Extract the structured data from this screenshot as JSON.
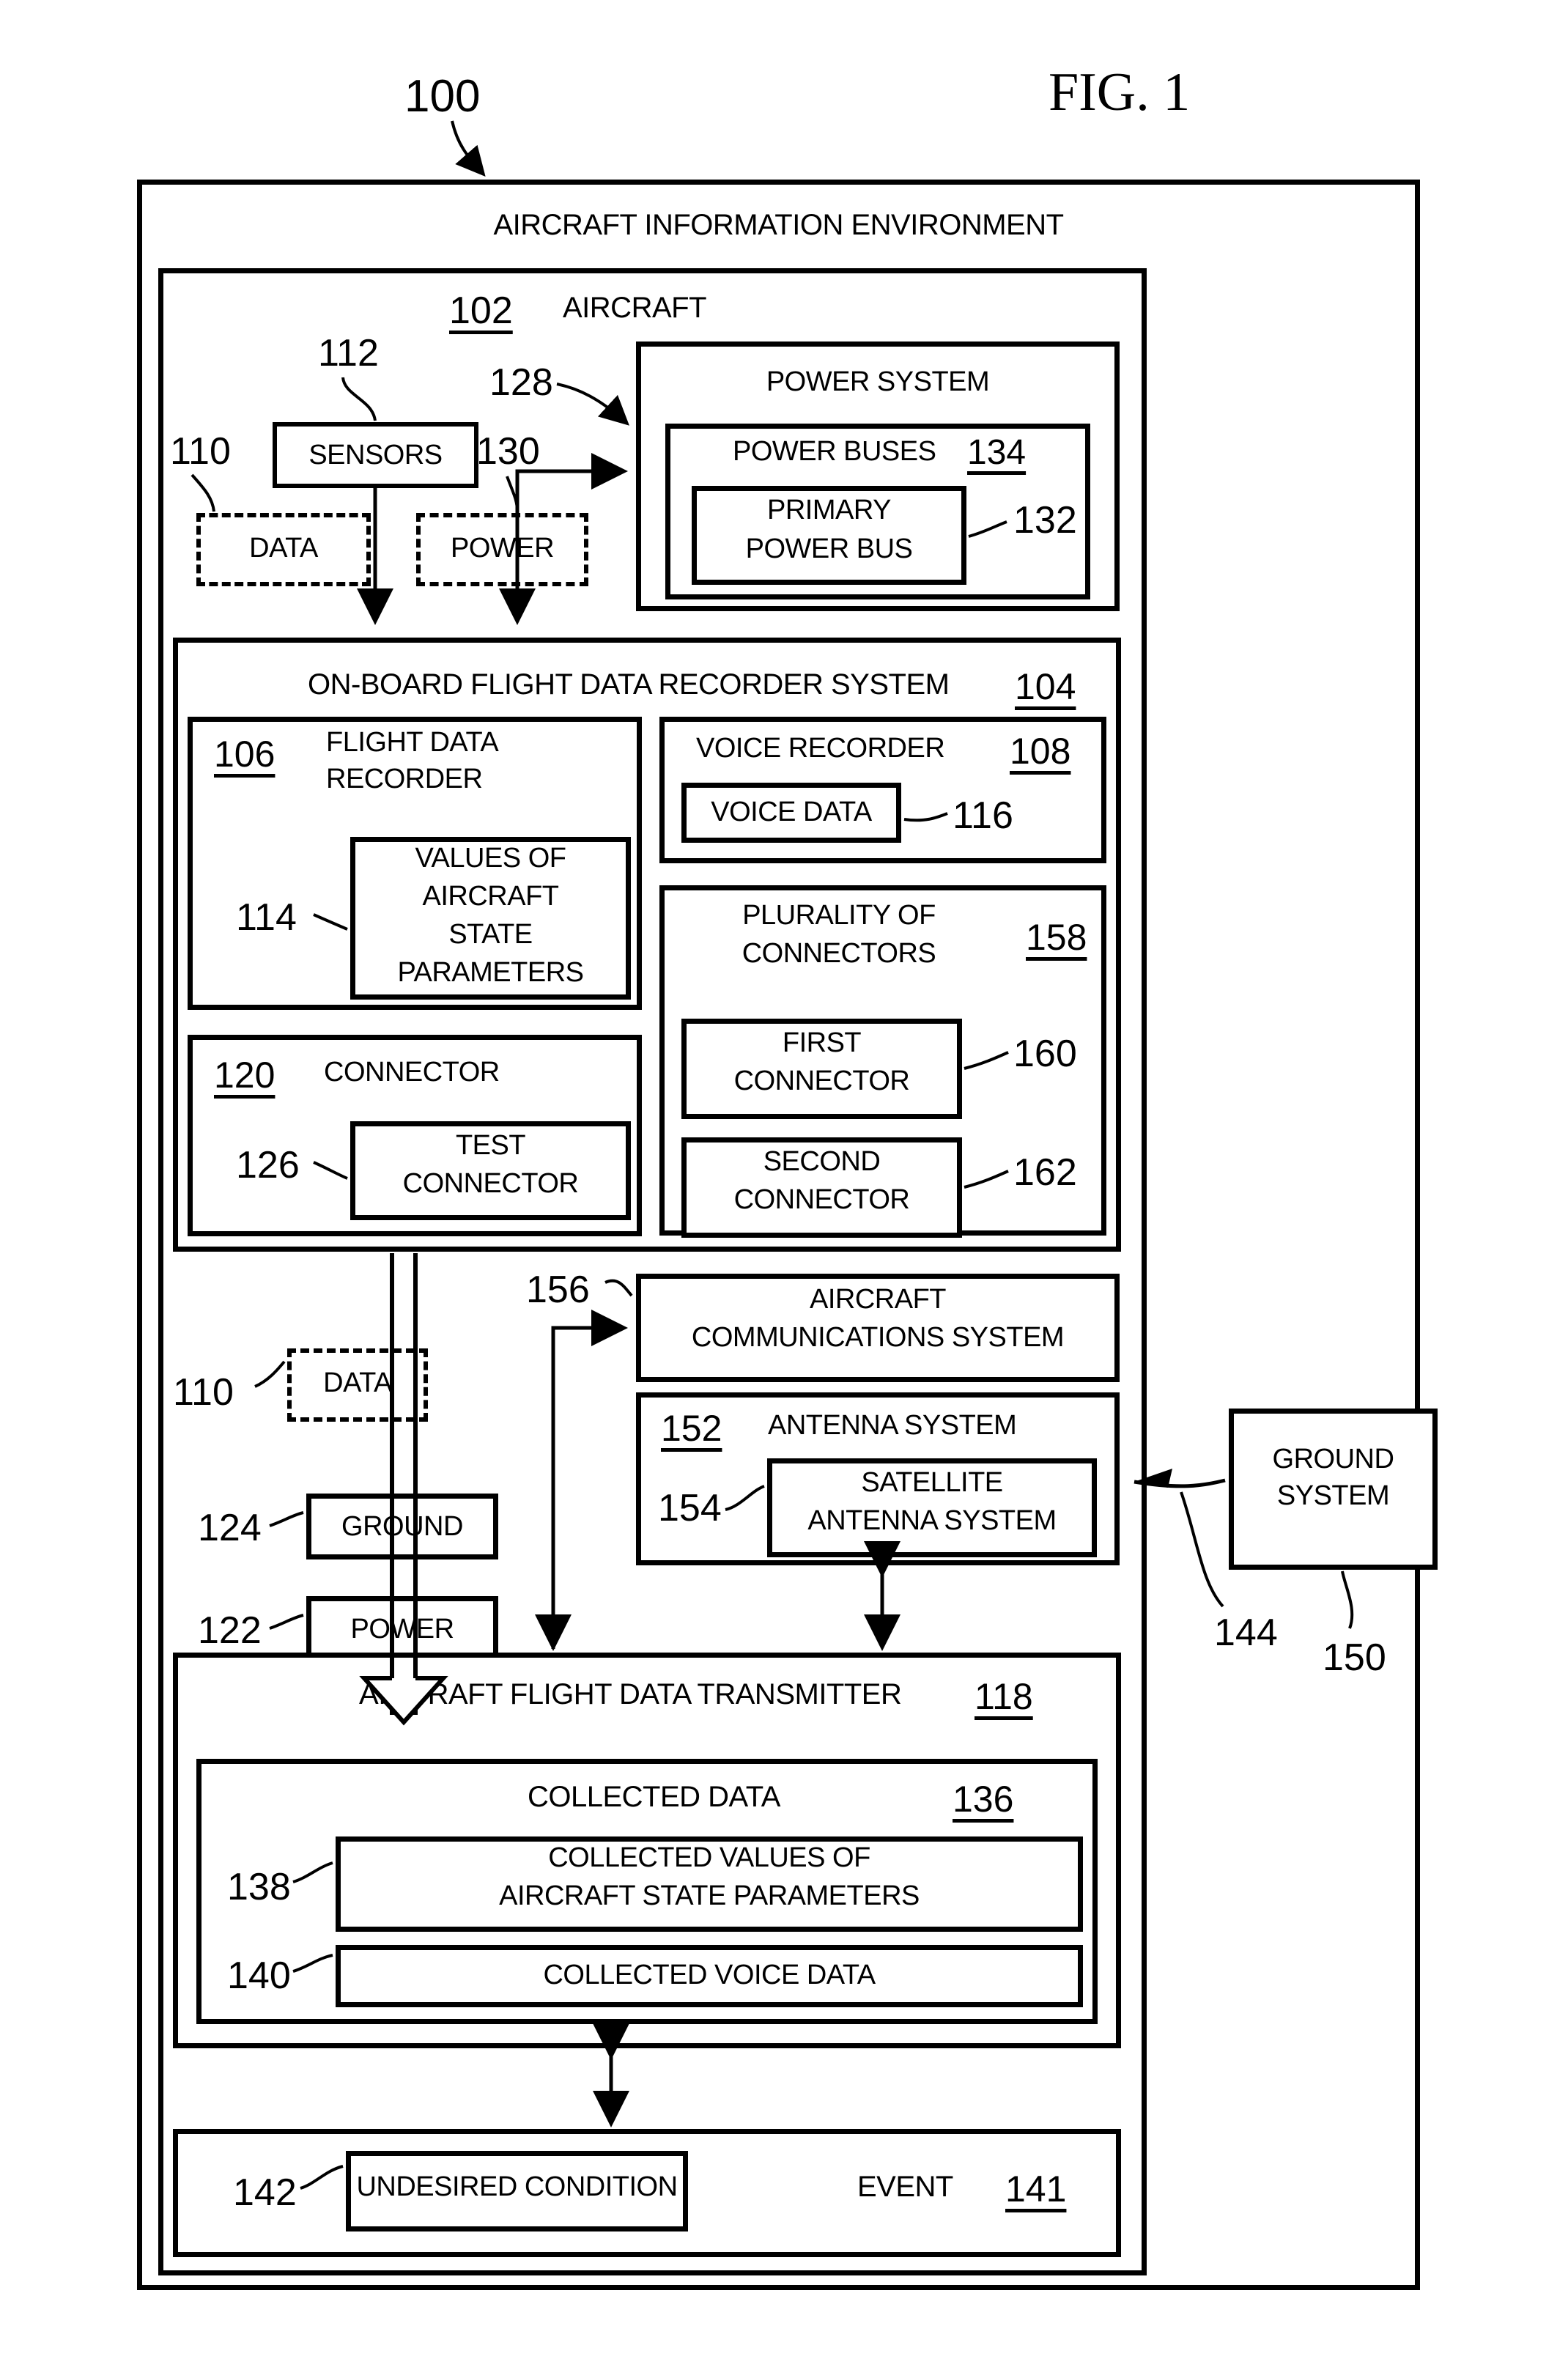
{
  "figure": {
    "label": "FIG. 1",
    "top_ref": "100"
  },
  "outer": {
    "title": "AIRCRAFT INFORMATION ENVIRONMENT"
  },
  "aircraft": {
    "ref": "102",
    "title": "AIRCRAFT",
    "sensors": {
      "ref": "112",
      "label": "SENSORS"
    },
    "data_dashed_top": {
      "ref": "110",
      "label": "DATA"
    },
    "power_dashed_top": {
      "ref": "130",
      "label": "POWER"
    },
    "power_arrow_ref": "128",
    "power_system": {
      "title": "POWER SYSTEM",
      "power_buses": {
        "ref": "134",
        "label": "POWER BUSES"
      },
      "primary_power_bus": {
        "ref": "132",
        "line1": "PRIMARY",
        "line2": "POWER BUS"
      }
    },
    "fdr_system": {
      "ref": "104",
      "title": "ON-BOARD FLIGHT DATA RECORDER SYSTEM",
      "flight_data_recorder": {
        "ref": "106",
        "line1": "FLIGHT DATA",
        "line2": "RECORDER",
        "values": {
          "ref": "114",
          "l1": "VALUES OF",
          "l2": "AIRCRAFT",
          "l3": "STATE",
          "l4": "PARAMETERS"
        }
      },
      "connector": {
        "ref": "120",
        "label": "CONNECTOR",
        "test_connector": {
          "ref": "126",
          "line1": "TEST",
          "line2": "CONNECTOR"
        }
      },
      "voice_recorder": {
        "ref": "108",
        "label": "VOICE RECORDER",
        "voice_data": {
          "ref": "116",
          "label": "VOICE DATA"
        }
      },
      "plurality_of_connectors": {
        "ref": "158",
        "line1": "PLURALITY OF",
        "line2": "CONNECTORS",
        "first_connector": {
          "ref": "160",
          "line1": "FIRST",
          "line2": "CONNECTOR"
        },
        "second_connector": {
          "ref": "162",
          "line1": "SECOND",
          "line2": "CONNECTOR"
        }
      }
    },
    "data_dashed_mid": {
      "ref": "110",
      "label": "DATA"
    },
    "ground_box": {
      "ref": "124",
      "label": "GROUND"
    },
    "power_box": {
      "ref": "122",
      "label": "POWER"
    },
    "comm_system": {
      "ref": "156",
      "line1": "AIRCRAFT",
      "line2": "COMMUNICATIONS SYSTEM"
    },
    "antenna_system": {
      "ref": "152",
      "label": "ANTENNA SYSTEM",
      "satellite_antenna_system": {
        "ref": "154",
        "line1": "SATELLITE",
        "line2": "ANTENNA SYSTEM"
      }
    },
    "transmitter": {
      "ref": "118",
      "title": "AIRCRAFT FLIGHT DATA TRANSMITTER",
      "collected_data": {
        "ref": "136",
        "label": "COLLECTED DATA",
        "collected_values": {
          "ref": "138",
          "line1": "COLLECTED VALUES OF",
          "line2": "AIRCRAFT STATE PARAMETERS"
        },
        "collected_voice": {
          "ref": "140",
          "label": "COLLECTED VOICE DATA"
        }
      }
    },
    "event": {
      "ref": "141",
      "label": "EVENT",
      "undesired_condition": {
        "ref": "142",
        "label": "UNDESIRED CONDITION"
      }
    }
  },
  "ground_system": {
    "ref_link": "144",
    "ref": "150",
    "line1": "GROUND",
    "line2": "SYSTEM"
  }
}
